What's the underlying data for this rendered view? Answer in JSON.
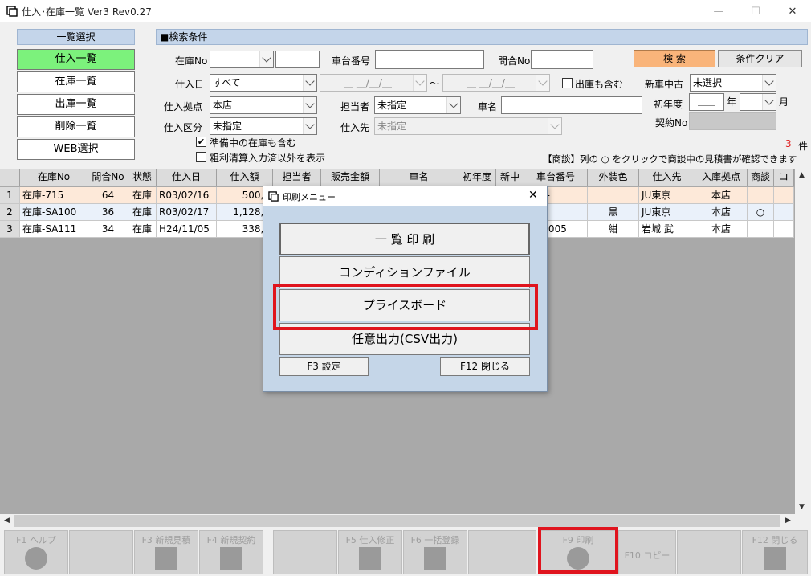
{
  "window": {
    "title": "仕入･在庫一覧 Ver3 Rev0.27",
    "minimize": "—",
    "maximize": "☐",
    "close": "✕"
  },
  "left_panel": {
    "header": "一覧選択",
    "items": [
      "仕入一覧",
      "在庫一覧",
      "出庫一覧",
      "削除一覧",
      "WEB選択"
    ]
  },
  "search": {
    "header": "■検索条件",
    "stock_no_label": "在庫No",
    "stock_no_combo": "",
    "stock_no_value": "",
    "chassis_no_label": "車台番号",
    "chassis_no_value": "",
    "inquiry_no_label": "問合No",
    "inquiry_no_value": "",
    "search_button": "検 索",
    "clear_button": "条件クリア",
    "purchase_date_label": "仕入日",
    "purchase_date_value": "すべて",
    "date_from": "＿ ＿/＿/＿",
    "date_tilde": "〜",
    "date_to": "＿ ＿/＿/＿",
    "include_shipped_label": "出庫も含む",
    "new_used_label": "新車中古",
    "new_used_value": "未選択",
    "branch_label": "仕入拠点",
    "branch_value": "本店",
    "staff_label": "担当者",
    "staff_value": "未指定",
    "car_name_label": "車名",
    "car_name_value": "",
    "first_year_label": "初年度",
    "first_year_value": "＿＿",
    "year_unit": "年",
    "month_value": "",
    "month_unit": "月",
    "category_label": "仕入区分",
    "category_value": "未指定",
    "supplier_label": "仕入先",
    "supplier_value": "未指定",
    "contract_no_label": "契約No",
    "contract_no_value": "",
    "include_preparing_label": "準備中の在庫も含む",
    "include_preparing_checked": "✔",
    "show_unsettled_label": "粗利清算入力済以外を表示",
    "show_unsettled_checked": "",
    "count_value": "3",
    "count_unit": "件",
    "negotiation_note": "【商談】列の ○ をクリックで商談中の見積書が確認できます"
  },
  "grid": {
    "columns": [
      "在庫No",
      "問合No",
      "状態",
      "仕入日",
      "仕入額",
      "担当者",
      "販売金額",
      "車名",
      "初年度",
      "新中",
      "車台番号",
      "外装色",
      "仕入先",
      "入庫拠点",
      "商談",
      "コ"
    ],
    "rows": [
      {
        "no": "1",
        "cells": [
          "在庫-715",
          "64",
          "在庫",
          "R03/02/16",
          "500,0",
          "",
          "",
          "",
          "",
          "",
          "61G-",
          "",
          "JU東京",
          "本店",
          "",
          ""
        ]
      },
      {
        "no": "2",
        "cells": [
          "在庫-SA100",
          "36",
          "在庫",
          "R03/02/17",
          "1,128,6",
          "",
          "",
          "",
          "",
          "",
          "-",
          "黒",
          "JU東京",
          "本店",
          "○",
          ""
        ]
      },
      {
        "no": "3",
        "cells": [
          "在庫-SA111",
          "34",
          "在庫",
          "H24/11/05",
          "338,8",
          "",
          "",
          "",
          "",
          "",
          "Y10-005",
          "紺",
          "岩城 武",
          "本店",
          "",
          ""
        ]
      }
    ]
  },
  "function_keys": [
    {
      "label": "F1 ヘルプ"
    },
    {
      "label": ""
    },
    {
      "label": "F3 新規見積"
    },
    {
      "label": "F4 新規契約"
    },
    {
      "label": ""
    },
    {
      "label": "F5 仕入修正"
    },
    {
      "label": "F6 一括登録"
    },
    {
      "label": ""
    },
    {
      "label": "F9 印刷"
    },
    {
      "label": "F10 コピー"
    },
    {
      "label": ""
    },
    {
      "label": "F12 閉じる"
    }
  ],
  "print_dialog": {
    "title": "印刷メニュー",
    "close": "✕",
    "buttons": [
      "一 覧 印 刷",
      "コンディションファイル",
      "プライスボード",
      "任意出力(CSV出力)"
    ],
    "settings_button": "F3 設定",
    "close_button": "F12 閉じる"
  },
  "colors": {
    "active_nav": "#7cf27c",
    "search_button": "#f9b47a",
    "highlight": "#e0141e",
    "count": "#e02020"
  }
}
